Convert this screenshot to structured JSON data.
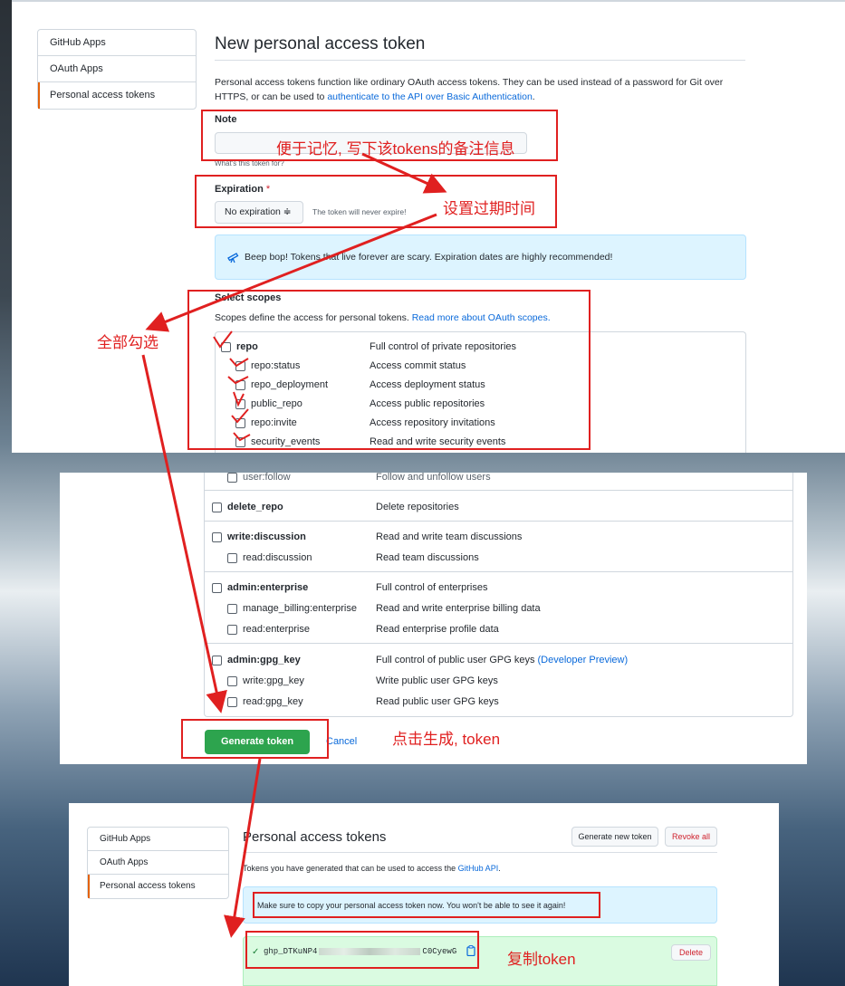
{
  "top": {
    "sidebar": [
      "GitHub Apps",
      "OAuth Apps",
      "Personal access tokens"
    ],
    "title": "New personal access token",
    "intro_line1": "Personal access tokens function like ordinary OAuth access tokens. They can be used instead of a password for Git over",
    "intro_line2_prefix": "HTTPS, or can be used to ",
    "intro_link": "authenticate to the API over Basic Authentication",
    "intro_line2_suffix": ".",
    "note_label": "Note",
    "note_hint": "What's this token for?",
    "expiration_label": "Expiration",
    "required_mark": "*",
    "expiration_value": "No expiration ≑",
    "expiration_note": "The token will never expire!",
    "flash": "Beep bop! Tokens that live forever are scary. Expiration dates are highly recommended!",
    "scopes_title": "Select scopes",
    "scopes_desc_prefix": "Scopes define the access for personal tokens. ",
    "scopes_link": "Read more about OAuth scopes.",
    "scopes": [
      {
        "name": "repo",
        "desc": "Full control of private repositories"
      },
      {
        "name": "repo:status",
        "desc": "Access commit status"
      },
      {
        "name": "repo_deployment",
        "desc": "Access deployment status"
      },
      {
        "name": "public_repo",
        "desc": "Access public repositories"
      },
      {
        "name": "repo:invite",
        "desc": "Access repository invitations"
      },
      {
        "name": "security_events",
        "desc": "Read and write security events"
      }
    ]
  },
  "middle": {
    "partial_name": "user:follow",
    "partial_desc": "Follow and unfollow users",
    "scopes": [
      {
        "name": "delete_repo",
        "desc": "Delete repositories"
      },
      {
        "name": "write:discussion",
        "desc": "Read and write team discussions"
      },
      {
        "name": "read:discussion",
        "desc": "Read team discussions"
      },
      {
        "name": "admin:enterprise",
        "desc": "Full control of enterprises"
      },
      {
        "name": "manage_billing:enterprise",
        "desc": "Read and write enterprise billing data"
      },
      {
        "name": "read:enterprise",
        "desc": "Read enterprise profile data"
      },
      {
        "name": "admin:gpg_key",
        "desc": "Full control of public user GPG keys "
      },
      {
        "name": "write:gpg_key",
        "desc": "Write public user GPG keys"
      },
      {
        "name": "read:gpg_key",
        "desc": "Read public user GPG keys"
      }
    ],
    "developer_preview": "(Developer Preview)",
    "generate_button": "Generate token",
    "cancel": "Cancel"
  },
  "bottom": {
    "sidebar": [
      "GitHub Apps",
      "OAuth Apps",
      "Personal access tokens"
    ],
    "title": "Personal access tokens",
    "generate_new": "Generate new token",
    "revoke_all": "Revoke all",
    "desc_prefix": "Tokens you have generated that can be used to access the ",
    "desc_link": "GitHub API",
    "desc_suffix": ".",
    "flash": "Make sure to copy your personal access token now. You won't be able to see it again!",
    "token_start": "ghp_DTKuNP4",
    "token_end": "C0CyewG",
    "delete": "Delete"
  },
  "annotations": {
    "note": "便于记忆, 写下该tokens的备注信息",
    "expiration": "设置过期时间",
    "select_all": "全部勾选",
    "generate": "点击生成, token",
    "copy": "复制token"
  },
  "colors": {
    "annotation": "#e02020",
    "link": "#0969da",
    "primary_button": "#2da44e",
    "flash_bg": "#ddf4ff"
  }
}
